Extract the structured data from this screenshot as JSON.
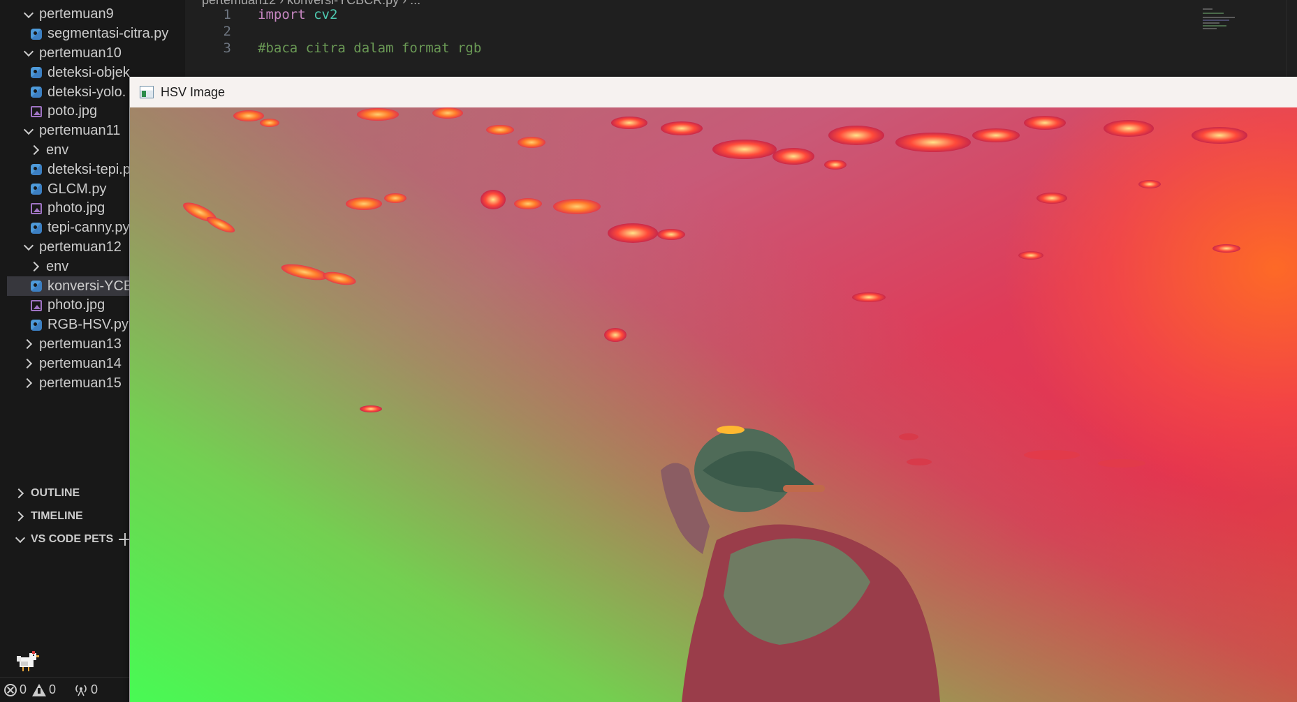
{
  "explorer": {
    "items": [
      {
        "label": "pertemuan9",
        "kind": "folder",
        "state": "expanded",
        "depth": 0
      },
      {
        "label": "segmentasi-citra.py",
        "kind": "python",
        "depth": 1
      },
      {
        "label": "pertemuan10",
        "kind": "folder",
        "state": "expanded",
        "depth": 0
      },
      {
        "label": "deteksi-objek",
        "kind": "python",
        "depth": 1
      },
      {
        "label": "deteksi-yolo.",
        "kind": "python",
        "depth": 1
      },
      {
        "label": "poto.jpg",
        "kind": "image",
        "depth": 1
      },
      {
        "label": "pertemuan11",
        "kind": "folder",
        "state": "expanded",
        "depth": 0
      },
      {
        "label": "env",
        "kind": "folder",
        "state": "collapsed",
        "depth": 1
      },
      {
        "label": "deteksi-tepi.p",
        "kind": "python",
        "depth": 1
      },
      {
        "label": "GLCM.py",
        "kind": "python",
        "depth": 1
      },
      {
        "label": "photo.jpg",
        "kind": "image",
        "depth": 1
      },
      {
        "label": "tepi-canny.py",
        "kind": "python",
        "depth": 1
      },
      {
        "label": "pertemuan12",
        "kind": "folder",
        "state": "expanded",
        "depth": 0
      },
      {
        "label": "env",
        "kind": "folder",
        "state": "collapsed",
        "depth": 1
      },
      {
        "label": "konversi-YCB",
        "kind": "python",
        "depth": 1,
        "selected": true
      },
      {
        "label": "photo.jpg",
        "kind": "image",
        "depth": 1
      },
      {
        "label": "RGB-HSV.py",
        "kind": "python",
        "depth": 1
      },
      {
        "label": "pertemuan13",
        "kind": "folder",
        "state": "collapsed",
        "depth": 0
      },
      {
        "label": "pertemuan14",
        "kind": "folder",
        "state": "collapsed",
        "depth": 0
      },
      {
        "label": "pertemuan15",
        "kind": "folder",
        "state": "collapsed",
        "depth": 0
      }
    ]
  },
  "sections": {
    "outline": "OUTLINE",
    "timeline": "TIMELINE",
    "vs_code_pets": "VS CODE PETS"
  },
  "editor": {
    "breadcrumb": "pertemuan12 › konversi-YCBCR.py › ...",
    "lines": [
      {
        "no": "1",
        "tokens": [
          {
            "t": "import",
            "c": "kw"
          },
          {
            "t": " ",
            "c": "plain"
          },
          {
            "t": "cv2",
            "c": "mod"
          }
        ]
      },
      {
        "no": "2",
        "tokens": []
      },
      {
        "no": "3",
        "tokens": [
          {
            "t": "#baca citra dalam format rgb",
            "c": "cmt"
          }
        ]
      }
    ]
  },
  "status": {
    "errors": "0",
    "warnings": "0",
    "ports": "0"
  },
  "hsv_window": {
    "title": "HSV Image"
  },
  "icons": {
    "folder_chevron": "chevron-icon",
    "python_file": "python-file-icon",
    "image_file": "image-file-icon",
    "add": "plus-icon",
    "pet": "chicken-pet-icon",
    "window_app": "opencv-window-icon"
  }
}
